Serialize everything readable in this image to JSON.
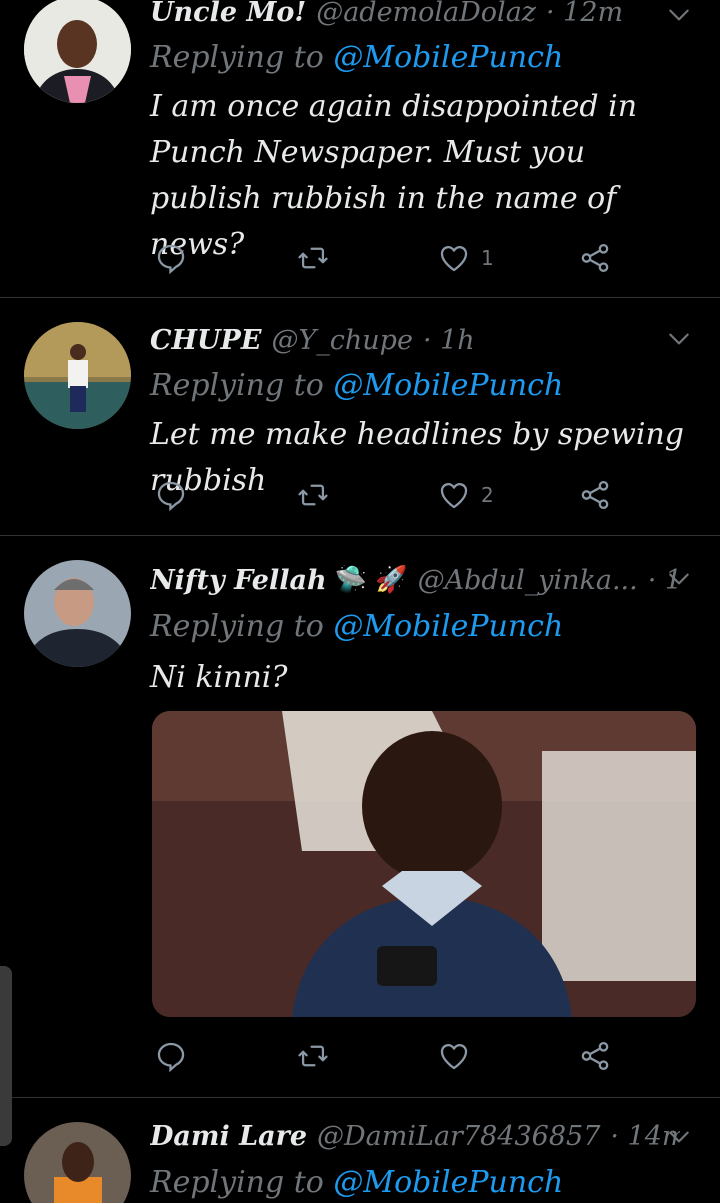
{
  "colors": {
    "accent": "#1d9bf0",
    "muted": "#71767b",
    "background": "#000000",
    "text": "#e7e9ea"
  },
  "tweets": [
    {
      "name": "Uncle Mo!",
      "handle": "@ademolaDolaz",
      "time": "· 12m",
      "replying_label": "Replying to ",
      "replying_to": "@MobilePunch",
      "text": "I am once again disappointed in Punch Newspaper. Must you publish rubbish in the name of news?",
      "likes": "1"
    },
    {
      "name": "CHUPE",
      "handle": "@Y_chupe",
      "time": "· 1h",
      "replying_label": "Replying to ",
      "replying_to": "@MobilePunch",
      "text": "Let me make headlines by spewing rubbish",
      "likes": "2"
    },
    {
      "name": "Nifty Fellah",
      "emoji": "🛸 🚀",
      "handle": "@Abdul_yinka...",
      "time": "· 1h",
      "replying_label": "Replying to ",
      "replying_to": "@MobilePunch",
      "text": "Ni kinni?",
      "likes": ""
    },
    {
      "name": "Dami Lare",
      "handle": "@DamiLar78436857",
      "time": "· 14m",
      "replying_label": "Replying to ",
      "replying_to": "@MobilePunch"
    }
  ],
  "icons": [
    "reply-icon",
    "retweet-icon",
    "like-icon",
    "share-icon",
    "chevron-down-icon"
  ]
}
